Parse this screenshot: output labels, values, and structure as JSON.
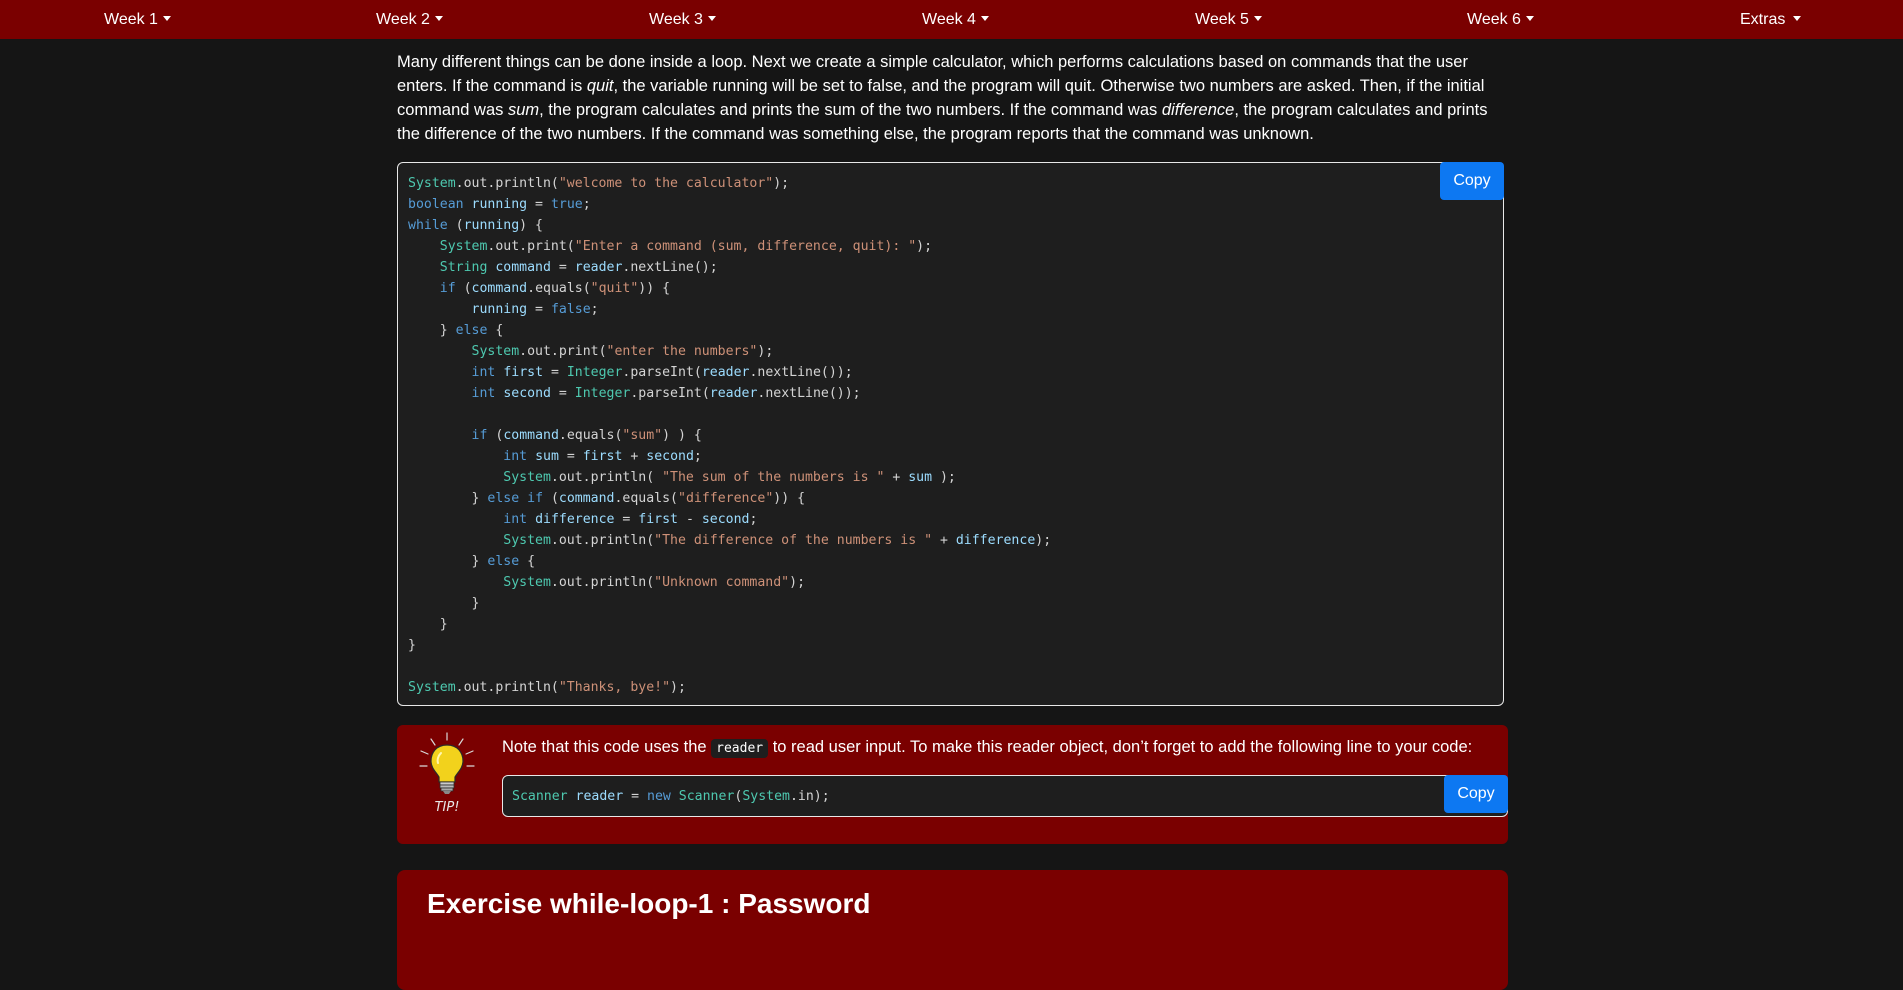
{
  "nav": {
    "items": [
      {
        "label": "Week 1"
      },
      {
        "label": "Week 2"
      },
      {
        "label": "Week 3"
      },
      {
        "label": "Week 4"
      },
      {
        "label": "Week 5"
      },
      {
        "label": "Week 6"
      },
      {
        "label": "Extras"
      }
    ]
  },
  "intro": {
    "p1": "Many different things can be done inside a loop. Next we create a simple calculator, which performs calculations based on commands that the user enters. If the command is ",
    "quit": "quit",
    "p2": ", the variable running will be set to false, and the program will quit. Otherwise two numbers are asked. Then, if the initial command was ",
    "sum": "sum",
    "p3": ", the program calculates and prints the sum of the two numbers. If the command was ",
    "difference": "difference",
    "p4": ", the program calculates and prints the difference of the two numbers. If the command was something else, the program reports that the command was unknown."
  },
  "code_block": {
    "copy_label": "Copy",
    "lines": [
      "System.out.println(\"welcome to the calculator\");",
      "boolean running = true;",
      "while (running) {",
      "    System.out.print(\"Enter a command (sum, difference, quit): \");",
      "    String command = reader.nextLine();",
      "    if (command.equals(\"quit\")) {",
      "        running = false;",
      "    } else {",
      "        System.out.print(\"enter the numbers\");",
      "        int first = Integer.parseInt(reader.nextLine());",
      "        int second = Integer.parseInt(reader.nextLine());",
      "",
      "        if (command.equals(\"sum\") ) {",
      "            int sum = first + second;",
      "            System.out.println( \"The sum of the numbers is \" + sum );",
      "        } else if (command.equals(\"difference\")) {",
      "            int difference = first - second;",
      "            System.out.println(\"The difference of the numbers is \" + difference);",
      "        } else {",
      "            System.out.println(\"Unknown command\");",
      "        }",
      "    }",
      "}",
      "",
      "System.out.println(\"Thanks, bye!\");"
    ]
  },
  "tip": {
    "icon_caption": "TIP!",
    "text_before": "Note that this code uses the ",
    "inline_code": "reader",
    "text_after": " to read user input. To make this reader object, don’t forget to add the following line to your code:",
    "code_line": "Scanner reader = new Scanner(System.in);",
    "copy_label": "Copy"
  },
  "exercise": {
    "title": "Exercise while-loop-1 : Password"
  },
  "colors": {
    "navbar_bg": "#7a0000",
    "page_bg": "#151515",
    "code_bg": "#1e1e1e",
    "copy_button": "#0d78f2",
    "type_color": "#4ec9b0",
    "keyword_color": "#569cd6",
    "variable_color": "#9cdcfe",
    "string_color": "#ce9178"
  }
}
